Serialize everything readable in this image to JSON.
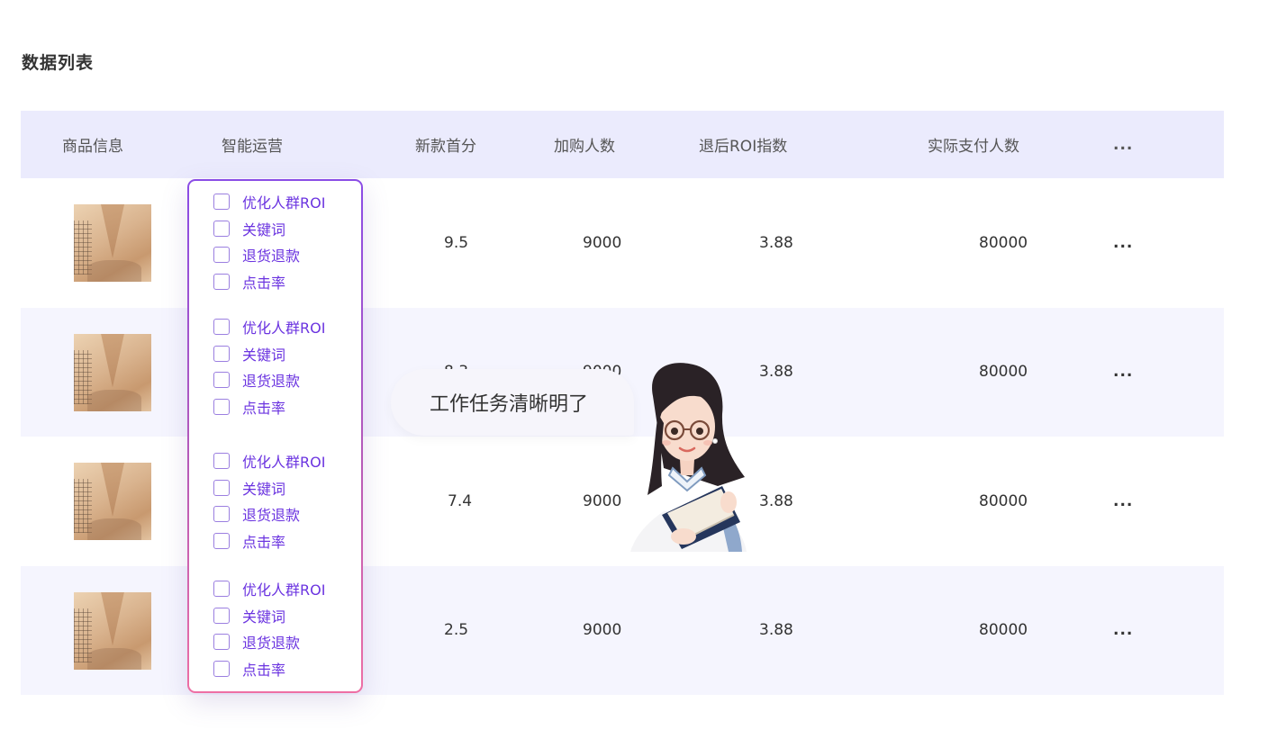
{
  "title": "数据列表",
  "table": {
    "headers": {
      "product": "商品信息",
      "smart_ops": "智能运营",
      "new_score": "新款首分",
      "cart_users": "加购人数",
      "refund_roi": "退后ROI指数",
      "paid_users": "实际支付人数",
      "more": "..."
    },
    "rows": [
      {
        "new_score": "9.5",
        "cart_users": "9000",
        "refund_roi": "3.88",
        "paid_users": "80000",
        "more": "..."
      },
      {
        "new_score": "8.3",
        "cart_users": "9000",
        "refund_roi": "3.88",
        "paid_users": "80000",
        "more": "..."
      },
      {
        "new_score": "7.4",
        "cart_users": "9000",
        "refund_roi": "3.88",
        "paid_users": "80000",
        "more": "..."
      },
      {
        "new_score": "2.5",
        "cart_users": "9000",
        "refund_roi": "3.88",
        "paid_users": "80000",
        "more": "..."
      }
    ]
  },
  "smart_ops_options": [
    [
      "优化人群ROI",
      "关键词",
      "退货退款",
      "点击率"
    ],
    [
      "优化人群ROI",
      "关键词",
      "退货退款",
      "点击率"
    ],
    [
      "优化人群ROI",
      "关键词",
      "退货退款",
      "点击率"
    ],
    [
      "优化人群ROI",
      "关键词",
      "退货退款",
      "点击率"
    ]
  ],
  "bubble_text": "工作任务清晰明了",
  "colors": {
    "header_bg": "#ebebfd",
    "alt_row_bg": "#f5f5fe",
    "option_text": "#6b34e0",
    "panel_border_top": "#8a4ce6",
    "panel_border_bottom": "#ee6fa4"
  },
  "icons": {
    "checkbox": "checkbox-icon",
    "mascot": "assistant-avatar-icon"
  }
}
